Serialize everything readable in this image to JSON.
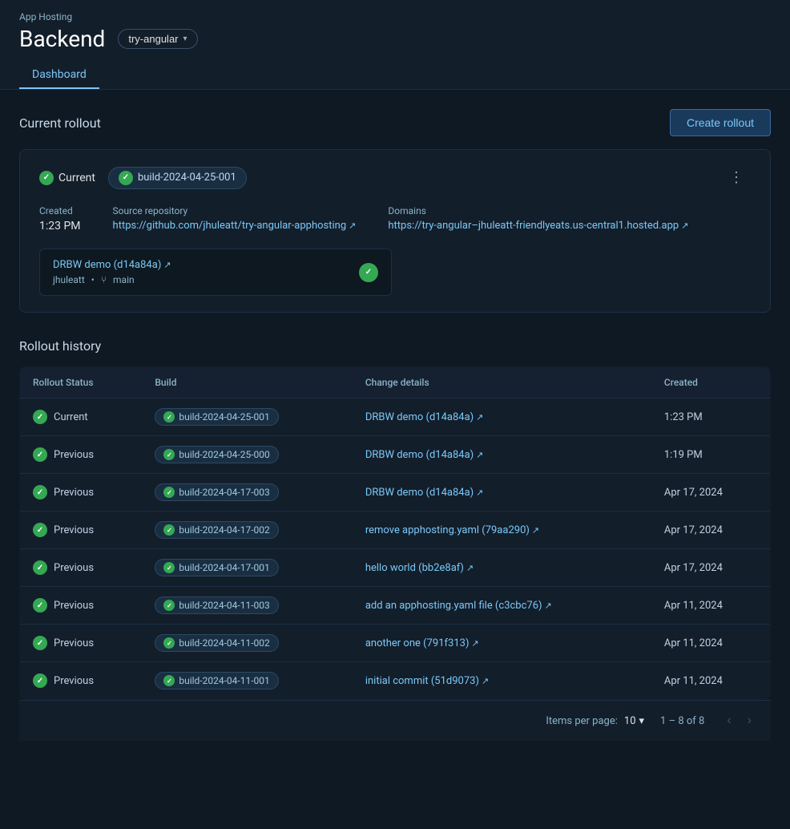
{
  "header": {
    "app_hosting_label": "App Hosting",
    "backend_title": "Backend",
    "branch_selector": "try-angular",
    "tabs": [
      {
        "label": "Dashboard",
        "active": true
      }
    ]
  },
  "current_rollout": {
    "section_title": "Current rollout",
    "create_button_label": "Create rollout",
    "status": "Current",
    "build_id": "build-2024-04-25-001",
    "created_label": "Created",
    "created_value": "1:23 PM",
    "source_repo_label": "Source repository",
    "source_repo_url": "https://github.com/jhuleatt/try-angular-apphosting",
    "domains_label": "Domains",
    "domain_url": "https://try-angular–jhuleatt-friendlyeats.us-central1.hosted.app",
    "commit_link_text": "DRBW demo (d14a84a)",
    "commit_author": "jhuleatt",
    "commit_branch": "main"
  },
  "rollout_history": {
    "section_title": "Rollout history",
    "table": {
      "headers": [
        "Rollout Status",
        "Build",
        "Change details",
        "Created"
      ],
      "rows": [
        {
          "status": "Current",
          "build": "build-2024-04-25-001",
          "change": "DRBW demo (d14a84a)",
          "change_link": true,
          "created": "1:23 PM"
        },
        {
          "status": "Previous",
          "build": "build-2024-04-25-000",
          "change": "DRBW demo (d14a84a)",
          "change_link": true,
          "created": "1:19 PM"
        },
        {
          "status": "Previous",
          "build": "build-2024-04-17-003",
          "change": "DRBW demo (d14a84a)",
          "change_link": true,
          "created": "Apr 17, 2024"
        },
        {
          "status": "Previous",
          "build": "build-2024-04-17-002",
          "change": "remove apphosting.yaml (79aa290)",
          "change_link": true,
          "created": "Apr 17, 2024"
        },
        {
          "status": "Previous",
          "build": "build-2024-04-17-001",
          "change": "hello world (bb2e8af)",
          "change_link": true,
          "created": "Apr 17, 2024"
        },
        {
          "status": "Previous",
          "build": "build-2024-04-11-003",
          "change": "add an apphosting.yaml file (c3cbc76)",
          "change_link": true,
          "created": "Apr 11, 2024"
        },
        {
          "status": "Previous",
          "build": "build-2024-04-11-002",
          "change": "another one (791f313)",
          "change_link": true,
          "created": "Apr 11, 2024"
        },
        {
          "status": "Previous",
          "build": "build-2024-04-11-001",
          "change": "initial commit (51d9073)",
          "change_link": true,
          "created": "Apr 11, 2024"
        }
      ]
    },
    "pagination": {
      "items_per_page_label": "Items per page:",
      "items_per_page_value": "10",
      "range_label": "1 – 8 of 8"
    }
  }
}
